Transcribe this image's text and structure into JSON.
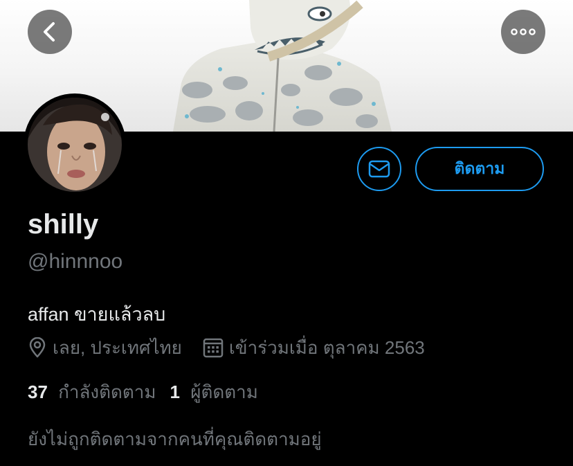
{
  "profile": {
    "display_name": "shilly",
    "handle": "@hinnnoo",
    "bio": "affan ขายแล้วลบ",
    "location": "เลย, ประเทศไทย",
    "joined": "เข้าร่วมเมื่อ ตุลาคม 2563",
    "following_count": "37",
    "following_label": "กำลังติดตาม",
    "followers_count": "1",
    "followers_label": "ผู้ติดตาม",
    "not_followed_note": "ยังไม่ถูกติดตามจากคนที่คุณติดตามอยู่"
  },
  "actions": {
    "follow_label": "ติดตาม",
    "back_icon": "chevron-left-icon",
    "more_icon": "more-horizontal-icon",
    "message_icon": "mail-icon",
    "location_icon": "location-pin-icon",
    "calendar_icon": "calendar-icon"
  },
  "colors": {
    "background": "#000000",
    "accent": "#1d9bf0",
    "primary_text": "#e7e9ea",
    "secondary_text": "#71767b"
  }
}
